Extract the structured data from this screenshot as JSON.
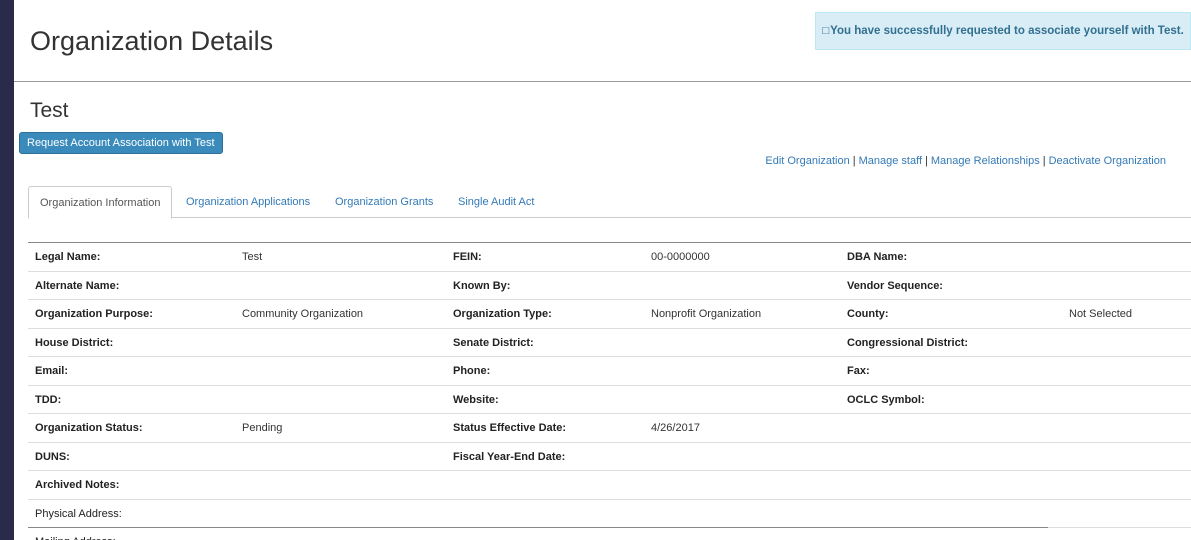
{
  "page": {
    "title": "Organization Details",
    "alert": {
      "icon": "□",
      "text": "You have successfully requested to associate yourself with Test."
    },
    "org_name": "Test",
    "request_button": "Request Account Association with Test",
    "actions": [
      "Edit Organization",
      "Manage staff",
      "Manage Relationships",
      "Deactivate Organization"
    ],
    "actions_separator": "|"
  },
  "tabs": [
    "Organization Information",
    "Organization Applications",
    "Organization Grants",
    "Single Audit Act"
  ],
  "info_rows": [
    {
      "l1": "Legal Name:",
      "v1": "Test",
      "l2": "FEIN:",
      "v2": "00-0000000",
      "l3": "DBA Name:",
      "v3": ""
    },
    {
      "l1": "Alternate Name:",
      "v1": "",
      "l2": "Known By:",
      "v2": "",
      "l3": "Vendor Sequence:",
      "v3": ""
    },
    {
      "l1": "Organization Purpose:",
      "v1": "Community Organization",
      "l2": "Organization Type:",
      "v2": "Nonprofit Organization",
      "l3": "County:",
      "v3": "Not Selected"
    },
    {
      "l1": "House District:",
      "v1": "",
      "l2": "Senate District:",
      "v2": "",
      "l3": "Congressional District:",
      "v3": ""
    },
    {
      "l1": "Email:",
      "v1": "",
      "l2": "Phone:",
      "v2": "",
      "l3": "Fax:",
      "v3": ""
    },
    {
      "l1": "TDD:",
      "v1": "",
      "l2": "Website:",
      "v2": "",
      "l3": "OCLC Symbol:",
      "v3": ""
    },
    {
      "l1": "Organization Status:",
      "v1": "Pending",
      "l2": "Status Effective Date:",
      "v2": "4/26/2017",
      "l3": "",
      "v3": ""
    },
    {
      "l1": "DUNS:",
      "v1": "",
      "l2": "Fiscal Year-End Date:",
      "v2": "",
      "l3": "",
      "v3": ""
    },
    {
      "l1": "Archived Notes:",
      "v1": "",
      "l2": "",
      "v2": "",
      "l3": "",
      "v3": ""
    }
  ],
  "address_rows": [
    "Physical Address:",
    "Mailing Address:"
  ]
}
